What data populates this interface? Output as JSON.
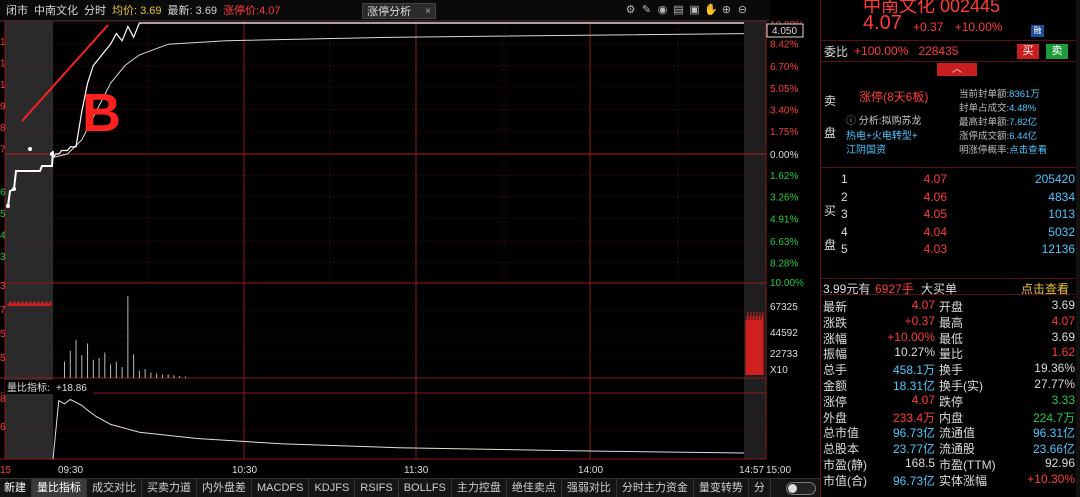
{
  "topbar": {
    "status": "闭市",
    "stock_name": "中南文化",
    "mode": "分时",
    "avg_label": "均价: 3.69",
    "last_label": "最新: 3.69",
    "limit_label": "涨停价:4.07",
    "analysis_tab": "涨停分析",
    "analysis_close": "×",
    "icons": [
      "settings-icon",
      "edit-icon",
      "eye-icon",
      "chart-icon",
      "lock-icon",
      "hand-icon",
      "zoom-in-icon",
      "zoom-out-icon"
    ]
  },
  "chart": {
    "price_badge": "4.050",
    "right_axis_main": [
      "10.00%",
      "8.42%",
      "6.70%",
      "5.05%",
      "3.40%",
      "1.75%",
      "0.00%",
      "1.62%",
      "3.26%",
      "4.91%",
      "6.63%",
      "8.28%",
      "10.00%"
    ],
    "left_axis_main": [
      "1",
      "1",
      "1",
      "9",
      "8",
      "7",
      "",
      "6",
      "5",
      "4",
      "3"
    ],
    "vol_axis": [
      "67325",
      "44592",
      "22733",
      "X10"
    ],
    "left_axis_vol": [
      "3",
      "7",
      "5",
      "5"
    ],
    "indicator_label": "量比指标:",
    "indicator_value": "+18.86",
    "left_axis_ind": [
      "8",
      "6"
    ],
    "time_labels": [
      "15",
      "09:30",
      "10:30",
      "11:30",
      "14:00",
      "14:57",
      "15:00"
    ],
    "annotation_letter": "B"
  },
  "tabs": [
    "新建",
    "量比指标",
    "成交对比",
    "买卖力道",
    "内外盘差",
    "MACDFS",
    "KDJFS",
    "RSIFS",
    "BOLLFS",
    "主力控盘",
    "绝佳卖点",
    "强弱对比",
    "分时主力资金",
    "量变转势",
    "分"
  ],
  "panel": {
    "title": "中南文化 002445",
    "price": "4.07",
    "change": "+0.37",
    "change_pct": "+10.00%",
    "rong": "融",
    "weibi_label": "委比",
    "weibi_pct": "+100.00%",
    "weibi_vol": "228435",
    "buy_btn": "买",
    "sell_btn": "卖",
    "collapse": "︿",
    "sell_label": "卖",
    "pan_label": "盘",
    "zt_tag": "涨停(8天6板)",
    "analysis_label": "分析:拟购苏龙",
    "concept1": "热电+火电转型+",
    "concept2": "江阴国资",
    "stats": [
      {
        "label": "当前封单额:",
        "value": "8361万"
      },
      {
        "label": "封单占成交:",
        "value": "4.48%"
      },
      {
        "label": "最高封单额:",
        "value": "7.82亿"
      },
      {
        "label": "涨停成交额:",
        "value": "6.44亿"
      },
      {
        "label": "明涨停概率:",
        "value": "点击查看"
      }
    ],
    "buy_label": "买",
    "buy_pan": "盘",
    "book": [
      {
        "lvl": "1",
        "price": "4.07",
        "vol": "205420"
      },
      {
        "lvl": "2",
        "price": "4.06",
        "vol": "4834"
      },
      {
        "lvl": "3",
        "price": "4.05",
        "vol": "1013"
      },
      {
        "lvl": "4",
        "price": "4.04",
        "vol": "5032"
      },
      {
        "lvl": "5",
        "price": "4.03",
        "vol": "12136"
      }
    ],
    "bigbuy": {
      "a": "3.99元有",
      "b": "6927手",
      "c": "大买单",
      "d": "点击查看"
    },
    "quote": [
      {
        "l1": "最新",
        "v1": "4.07",
        "c1": "q-red",
        "l2": "开盘",
        "v2": "3.69",
        "c2": "q-white"
      },
      {
        "l1": "涨跌",
        "v1": "+0.37",
        "c1": "q-red",
        "l2": "最高",
        "v2": "4.07",
        "c2": "q-red"
      },
      {
        "l1": "涨幅",
        "v1": "+10.00%",
        "c1": "q-red",
        "l2": "最低",
        "v2": "3.69",
        "c2": "q-white"
      },
      {
        "l1": "振幅",
        "v1": "10.27%",
        "c1": "q-white",
        "l2": "量比",
        "v2": "1.62",
        "c2": "q-red"
      },
      {
        "l1": "总手",
        "v1": "458.1万",
        "c1": "q-cyan",
        "l2": "换手",
        "v2": "19.36%",
        "c2": "q-white"
      },
      {
        "l1": "金额",
        "v1": "18.31亿",
        "c1": "q-cyan",
        "l2": "换手(实)",
        "v2": "27.77%",
        "c2": "q-white"
      },
      {
        "l1": "涨停",
        "v1": "4.07",
        "c1": "q-red",
        "l2": "跌停",
        "v2": "3.33",
        "c2": "q-green"
      },
      {
        "l1": "外盘",
        "v1": "233.4万",
        "c1": "q-red",
        "l2": "内盘",
        "v2": "224.7万",
        "c2": "q-green"
      },
      {
        "l1": "总市值",
        "v1": "96.73亿",
        "c1": "q-cyan",
        "l2": "流通值",
        "v2": "96.31亿",
        "c2": "q-cyan"
      },
      {
        "l1": "总股本",
        "v1": "23.77亿",
        "c1": "q-cyan",
        "l2": "流通股",
        "v2": "23.66亿",
        "c2": "q-cyan"
      },
      {
        "l1": "市盈(静)",
        "v1": "168.5",
        "c1": "q-white",
        "l2": "市盈(TTM)",
        "v2": "92.96",
        "c2": "q-white"
      },
      {
        "l1": "市值(合)",
        "v1": "96.73亿",
        "c1": "q-cyan",
        "l2": "实体涨幅",
        "v2": "+10.30%",
        "c2": "q-red"
      }
    ]
  },
  "chart_data": {
    "type": "line",
    "title": "中南文化 分时",
    "prev_close": 3.7,
    "price_series": {
      "name": "最新",
      "x_minutes": [
        0,
        1,
        2,
        3,
        4,
        5,
        6,
        8,
        10,
        12,
        14,
        16,
        18,
        20,
        22,
        24,
        26,
        28,
        30,
        33,
        36,
        40,
        45,
        50,
        60,
        80,
        120,
        180,
        240
      ],
      "values": [
        3.69,
        3.7,
        3.7,
        3.71,
        3.71,
        3.71,
        3.72,
        3.72,
        3.82,
        3.9,
        3.95,
        3.97,
        3.99,
        4.01,
        4.04,
        4.02,
        4.06,
        4.03,
        4.07,
        4.07,
        4.07,
        4.07,
        4.07,
        4.07,
        4.07,
        4.07,
        4.07,
        4.07,
        4.07
      ]
    },
    "avg_series": {
      "name": "均价",
      "x_minutes": [
        0,
        5,
        10,
        15,
        20,
        25,
        30,
        40,
        60,
        120,
        240
      ],
      "values": [
        3.69,
        3.7,
        3.74,
        3.82,
        3.9,
        3.95,
        3.98,
        4.01,
        4.02,
        4.03,
        4.04
      ]
    },
    "volume_bars_x_minutes": [
      4,
      6,
      8,
      10,
      12,
      14,
      16,
      18,
      20,
      22,
      24,
      26,
      28,
      30,
      32,
      34,
      36,
      38,
      40,
      42,
      44,
      46
    ],
    "volume_bars_values": [
      18000,
      30000,
      42000,
      25000,
      38000,
      20000,
      22000,
      28000,
      15000,
      18000,
      12000,
      90000,
      26000,
      8000,
      10000,
      6000,
      5000,
      4000,
      4000,
      3000,
      2000,
      1500
    ],
    "indicator_series": {
      "name": "量比指标",
      "x_minutes": [
        0,
        2,
        4,
        6,
        8,
        10,
        12,
        15,
        20,
        30,
        50,
        80,
        120,
        180,
        240
      ],
      "values": [
        0,
        18.5,
        17.5,
        18.9,
        18.0,
        17.0,
        15.5,
        13.5,
        11.0,
        8.5,
        6.5,
        4.8,
        3.6,
        2.6,
        1.9
      ]
    },
    "ylim_pct": [
      -10,
      10
    ]
  }
}
